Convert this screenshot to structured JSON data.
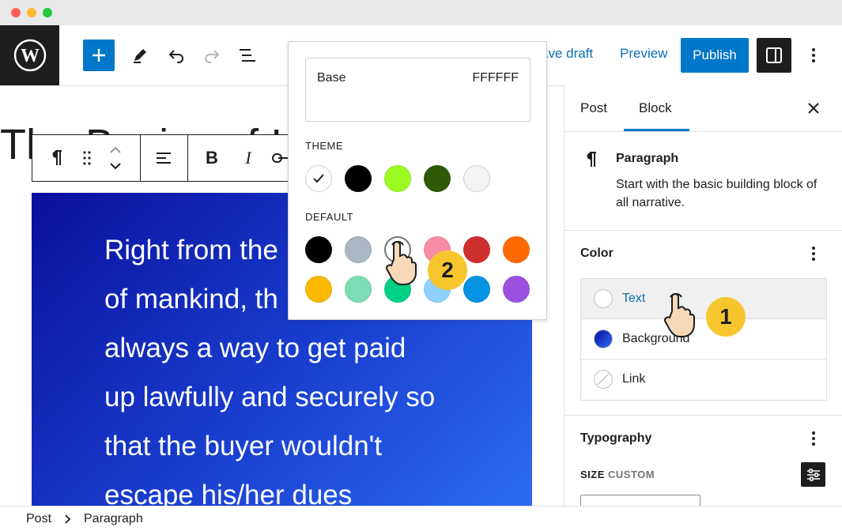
{
  "topbar": {
    "save_draft": "ave draft",
    "preview": "Preview",
    "publish": "Publish"
  },
  "canvas": {
    "title": "The Basics of I",
    "cover_text": "Right from the of mankind, th always a way to get paid up lawfully and securely so that the buyer wouldn't escape his/her dues"
  },
  "cover_lines": [
    "Right from the",
    "of mankind, th",
    "always a way to get paid",
    "up lawfully and securely so",
    "that the buyer wouldn't",
    "escape his/her dues"
  ],
  "sidebar": {
    "tabs": [
      "Post",
      "Block"
    ],
    "block_name": "Paragraph",
    "block_desc": "Start with the basic building block of all narrative.",
    "color_heading": "Color",
    "color_items": [
      "Text",
      "Background",
      "Link"
    ],
    "typography_heading": "Typography",
    "size_label": "SIZE",
    "size_custom": "CUSTOM"
  },
  "popover": {
    "selected_name": "Base",
    "selected_hex": "FFFFFF",
    "theme_label": "THEME",
    "default_label": "DEFAULT",
    "theme_colors": [
      "#ffffff",
      "#000000",
      "#9bfb20",
      "#2f5b07",
      "#f3f3f3"
    ],
    "default_colors": [
      "#000000",
      "#abb8c3",
      "#ffffff",
      "#f78da7",
      "#cf2e2e",
      "#ff6900",
      "#fcb900",
      "#7bdcb5",
      "#00d084",
      "#8ed1fc",
      "#0693e3",
      "#9b51e0"
    ]
  },
  "breadcrumb": [
    "Post",
    "Paragraph"
  ],
  "badges": [
    "1",
    "2"
  ],
  "colors": {
    "accent": "#0077c8",
    "badge": "#f7c62f",
    "dark": "#1e1e1e"
  }
}
